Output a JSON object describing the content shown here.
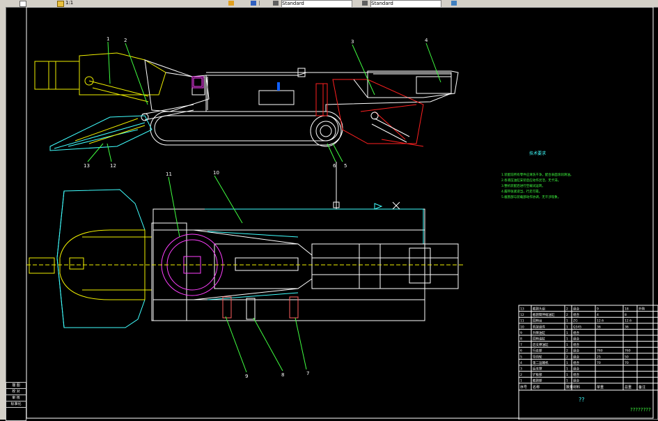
{
  "toolbar": {
    "left_box": "1:1",
    "style_box": "Standard",
    "dim_box": "Standard"
  },
  "title": {
    "tech_req": "技术要求",
    "tech_lines": [
      "1.装配前所有零件应清洗干净，配合表面涂润滑油。",
      "2.各液压油缸安装后应动作灵活，无卡滞。",
      "3.整机装配后进行空载试运转。",
      "4.履带张紧适当，行走可靠。",
      "5.截割部与装载部动作协调，无干涉现象。"
    ]
  },
  "balloons": [
    "1",
    "2",
    "3",
    "4",
    "5",
    "6",
    "7",
    "8",
    "9",
    "10",
    "11",
    "12",
    "13"
  ],
  "bom": {
    "rows": [
      {
        "no": "13",
        "name": "截割头组",
        "qty": "2",
        "mat": "组合",
        "weight": "9",
        "total": "18",
        "note": "外购"
      },
      {
        "no": "12",
        "name": "截割臂伸缩油缸",
        "qty": "2",
        "mat": "组合",
        "weight": "4",
        "total": "8",
        "note": ""
      },
      {
        "no": "11",
        "name": "回转台",
        "qty": "1",
        "mat": "ZG",
        "weight": "12.6",
        "total": "12.6",
        "note": ""
      },
      {
        "no": "10",
        "name": "机架组件",
        "qty": "1",
        "mat": "Q345",
        "weight": "36",
        "total": "36",
        "note": ""
      },
      {
        "no": "9",
        "name": "升降油缸",
        "qty": "1",
        "mat": "组合",
        "weight": "",
        "total": "",
        "note": ""
      },
      {
        "no": "8",
        "name": "回转油缸",
        "qty": "1",
        "mat": "组合",
        "weight": "",
        "total": "",
        "note": ""
      },
      {
        "no": "7",
        "name": "后支撑油缸",
        "qty": "1",
        "mat": "组合",
        "weight": "",
        "total": "",
        "note": ""
      },
      {
        "no": "6",
        "name": "行走部",
        "qty": "2",
        "mat": "组合",
        "weight": "760",
        "total": "760",
        "note": ""
      },
      {
        "no": "5",
        "name": "导向轮",
        "qty": "2",
        "mat": "组合",
        "weight": "25",
        "total": "50",
        "note": ""
      },
      {
        "no": "4",
        "name": "第二运输机",
        "qty": "1",
        "mat": "组合",
        "weight": "70",
        "total": "70",
        "note": ""
      },
      {
        "no": "3",
        "name": "后支撑",
        "qty": "1",
        "mat": "组合",
        "weight": "",
        "total": "",
        "note": ""
      },
      {
        "no": "2",
        "name": "铲板部",
        "qty": "1",
        "mat": "组合",
        "weight": "",
        "total": "",
        "note": ""
      },
      {
        "no": "1",
        "name": "截割部",
        "qty": "1",
        "mat": "组合",
        "weight": "",
        "total": "",
        "note": ""
      }
    ],
    "header": [
      "序号",
      "名称",
      "数量",
      "材料",
      "单重",
      "总重",
      "备注"
    ],
    "title_block_code": "??",
    "title_block_name": "????????"
  },
  "left_panel": [
    "描 图",
    "校 对",
    "审 核",
    "标准化"
  ]
}
